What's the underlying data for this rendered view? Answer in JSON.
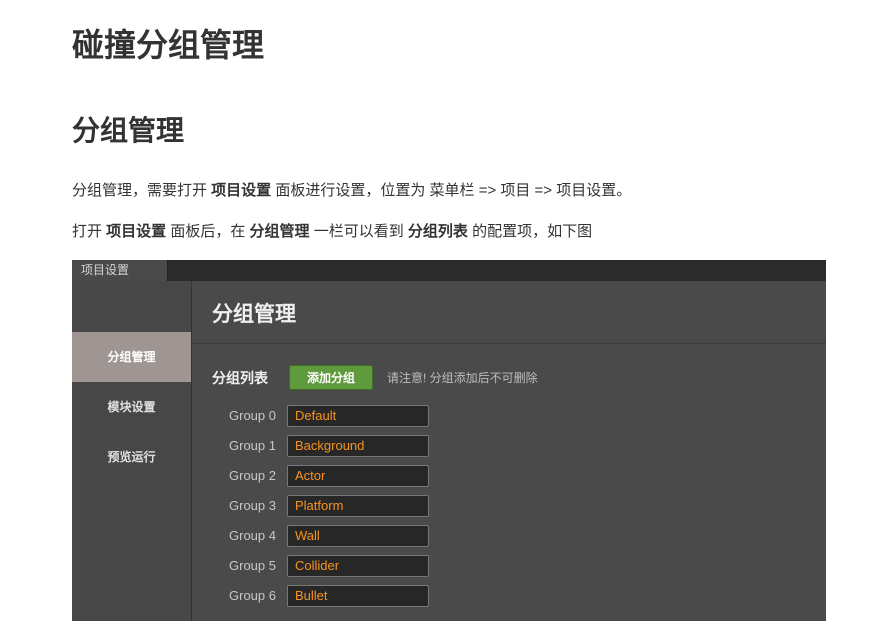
{
  "doc": {
    "h1": "碰撞分组管理",
    "h2": "分组管理",
    "p1": {
      "t1": "分组管理，需要打开 ",
      "b1": "项目设置",
      "t2": " 面板进行设置，位置为 菜单栏 => 项目 => 项目设置。"
    },
    "p2": {
      "t1": "打开 ",
      "b1": "项目设置",
      "t2": " 面板后，在 ",
      "b2": "分组管理",
      "t3": " 一栏可以看到 ",
      "b3": "分组列表",
      "t4": " 的配置项，如下图"
    }
  },
  "panel": {
    "tab": "项目设置",
    "sidebar": [
      "分组管理",
      "模块设置",
      "预览运行"
    ],
    "title": "分组管理",
    "list_label": "分组列表",
    "add_button": "添加分组",
    "notice": "请注意! 分组添加后不可删除",
    "groups": [
      {
        "label": "Group 0",
        "value": "Default"
      },
      {
        "label": "Group 1",
        "value": "Background"
      },
      {
        "label": "Group 2",
        "value": "Actor"
      },
      {
        "label": "Group 3",
        "value": "Platform"
      },
      {
        "label": "Group 4",
        "value": "Wall"
      },
      {
        "label": "Group 5",
        "value": "Collider"
      },
      {
        "label": "Group 6",
        "value": "Bullet"
      }
    ]
  },
  "colors": {
    "active_sidebar": "#9f9592",
    "add_button": "#5f9a3c",
    "group_value_text": "#f7941e"
  }
}
